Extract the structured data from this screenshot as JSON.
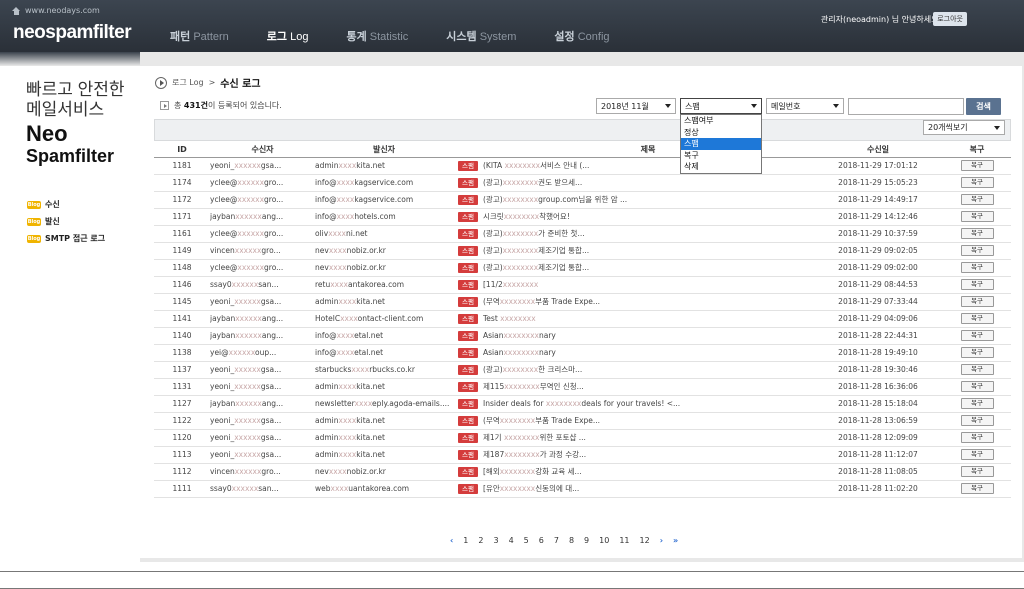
{
  "header": {
    "site_url": "www.neodays.com",
    "logo": "neospamfilter",
    "nav": [
      {
        "ko": "패턴",
        "en": "Pattern"
      },
      {
        "ko": "로그",
        "en": "Log"
      },
      {
        "ko": "통계",
        "en": "Statistic"
      },
      {
        "ko": "시스템",
        "en": "System"
      },
      {
        "ko": "설정",
        "en": "Config"
      }
    ],
    "user_greeting": "관리자(neoadmin) 님 안녕하세요.",
    "logout": "로그아웃"
  },
  "sidebar": {
    "tagline1": "빠르고 안전한",
    "tagline2": "메일서비스",
    "brand1": "Neo",
    "brand2": "Spamfilter",
    "items": [
      {
        "label": "수신"
      },
      {
        "label": "발신"
      },
      {
        "label": "SMTP 접근 로그"
      }
    ]
  },
  "breadcrumb": {
    "parent": "로그 Log",
    "sep": ">",
    "current": "수신 로그"
  },
  "count": {
    "prefix": "총 ",
    "value": "431건",
    "suffix": "이 등록되어 있습니다."
  },
  "filters": {
    "date": "2018년 11월",
    "type": "스팸",
    "field": "메일번호",
    "search_value": "",
    "search_button": "검색",
    "type_options": [
      "스팸여부",
      "정상",
      "스팸",
      "복구",
      "삭제"
    ],
    "type_selected_index": 2,
    "per_page": "20개씩보기"
  },
  "table": {
    "headers": [
      "ID",
      "수신자",
      "발신자",
      "",
      "제목",
      "수신일",
      "복구"
    ],
    "badge": "스팸",
    "restore_label": "복구",
    "rows": [
      {
        "id": "1181",
        "to": "yeoni_",
        "to2": "gsa...",
        "from": "admin",
        "from2": "kita.net",
        "subj": "(KITA ",
        "subj2": "서비스 안내 (...",
        "date": "2018-11-29 17:01:12"
      },
      {
        "id": "1174",
        "to": "yclee@",
        "to2": "gro...",
        "from": "info@",
        "from2": "kagservice.com",
        "subj": "(광고)",
        "subj2": "권도 받으세...",
        "date": "2018-11-29 15:05:23"
      },
      {
        "id": "1172",
        "to": "yclee@",
        "to2": "gro...",
        "from": "info@",
        "from2": "kagservice.com",
        "subj": "(광고)",
        "subj2": "group.com님을 위한 암 ...",
        "date": "2018-11-29 14:49:17"
      },
      {
        "id": "1171",
        "to": "jayban",
        "to2": "ang...",
        "from": "info@",
        "from2": "hotels.com",
        "subj": "시크릿",
        "subj2": "착했어요!",
        "date": "2018-11-29 14:12:46"
      },
      {
        "id": "1161",
        "to": "yclee@",
        "to2": "gro...",
        "from": "oliv",
        "from2": "ni.net",
        "subj": "(광고)",
        "subj2": "가 준비한 첫...",
        "date": "2018-11-29 10:37:59"
      },
      {
        "id": "1149",
        "to": "vincen",
        "to2": "gro...",
        "from": "nev",
        "from2": "nobiz.or.kr",
        "subj": "(광고)",
        "subj2": "제조기업 통합...",
        "date": "2018-11-29 09:02:05"
      },
      {
        "id": "1148",
        "to": "yclee@",
        "to2": "gro...",
        "from": "nev",
        "from2": "nobiz.or.kr",
        "subj": "(광고)",
        "subj2": "제조기업 통합...",
        "date": "2018-11-29 09:02:00"
      },
      {
        "id": "1146",
        "to": "ssay0",
        "to2": "san...",
        "from": "retu",
        "from2": "antakorea.com",
        "subj": "[11/2",
        "subj2": "",
        "date": "2018-11-29 08:44:53"
      },
      {
        "id": "1145",
        "to": "yeoni_",
        "to2": "gsa...",
        "from": "admin",
        "from2": "kita.net",
        "subj": "(무역",
        "subj2": "부품 Trade Expe...",
        "date": "2018-11-29 07:33:44"
      },
      {
        "id": "1141",
        "to": "jayban",
        "to2": "ang...",
        "from": "HotelC",
        "from2": "ontact-client.com",
        "subj": "Test ",
        "subj2": "",
        "date": "2018-11-29 04:09:06"
      },
      {
        "id": "1140",
        "to": "jayban",
        "to2": "ang...",
        "from": "info@",
        "from2": "etal.net",
        "subj": "Asian",
        "subj2": "nary",
        "date": "2018-11-28 22:44:31"
      },
      {
        "id": "1138",
        "to": "yei@",
        "to2": "oup...",
        "from": "info@",
        "from2": "etal.net",
        "subj": "Asian",
        "subj2": "nary",
        "date": "2018-11-28 19:49:10"
      },
      {
        "id": "1137",
        "to": "yeoni_",
        "to2": "gsa...",
        "from": "starbucks",
        "from2": "rbucks.co.kr",
        "subj": "(광고)",
        "subj2": "한 크리스마...",
        "date": "2018-11-28 19:30:46"
      },
      {
        "id": "1131",
        "to": "yeoni_",
        "to2": "gsa...",
        "from": "admin",
        "from2": "kita.net",
        "subj": "제115",
        "subj2": "무역인 신청...",
        "date": "2018-11-28 16:36:06"
      },
      {
        "id": "1127",
        "to": "jayban",
        "to2": "ang...",
        "from": "newsletter",
        "from2": "eply.agoda-emails....",
        "subj": "Insider deals for ",
        "subj2": "deals for your travels! <...",
        "date": "2018-11-28 15:18:04"
      },
      {
        "id": "1122",
        "to": "yeoni_",
        "to2": "gsa...",
        "from": "admin",
        "from2": "kita.net",
        "subj": "(무역",
        "subj2": "부품 Trade Expe...",
        "date": "2018-11-28 13:06:59"
      },
      {
        "id": "1120",
        "to": "yeoni_",
        "to2": "gsa...",
        "from": "admin",
        "from2": "kita.net",
        "subj": "제1기 ",
        "subj2": "위한 포토샵 ...",
        "date": "2018-11-28 12:09:09"
      },
      {
        "id": "1113",
        "to": "yeoni_",
        "to2": "gsa...",
        "from": "admin",
        "from2": "kita.net",
        "subj": "제187",
        "subj2": "가 과정 수강...",
        "date": "2018-11-28 11:12:07"
      },
      {
        "id": "1112",
        "to": "vincen",
        "to2": "gro...",
        "from": "nev",
        "from2": "nobiz.or.kr",
        "subj": "[해외",
        "subj2": "강화 교육 세...",
        "date": "2018-11-28 11:08:05"
      },
      {
        "id": "1111",
        "to": "ssay0",
        "to2": "san...",
        "from": "web",
        "from2": "uantakorea.com",
        "subj": "[유안",
        "subj2": "신동의에 대...",
        "date": "2018-11-28 11:02:20"
      }
    ]
  },
  "pager": {
    "first": "‹",
    "pages": [
      "1",
      "2",
      "3",
      "4",
      "5",
      "6",
      "7",
      "8",
      "9",
      "10",
      "11",
      "12"
    ],
    "next": "›",
    "last": "»"
  }
}
